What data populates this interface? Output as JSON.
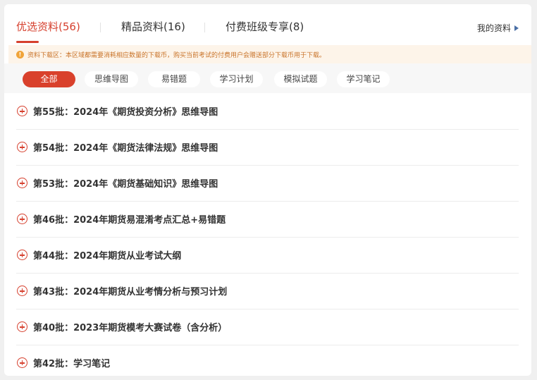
{
  "tabs": [
    {
      "label": "优选资料(56)",
      "active": true
    },
    {
      "label": "精品资料(16)",
      "active": false
    },
    {
      "label": "付费班级专享(8)",
      "active": false
    }
  ],
  "my_link": "我的资料",
  "notice": {
    "icon": "info-icon",
    "text": "资料下载区：本区域都需要消耗相应数量的下载币，购买当前考试的付费用户会赠送部分下载币用于下载。"
  },
  "filters": [
    {
      "label": "全部",
      "active": true
    },
    {
      "label": "思维导图",
      "active": false
    },
    {
      "label": "易错题",
      "active": false
    },
    {
      "label": "学习计划",
      "active": false
    },
    {
      "label": "模拟试题",
      "active": false
    },
    {
      "label": "学习笔记",
      "active": false
    }
  ],
  "items": [
    "第55批：2024年《期货投资分析》思维导图",
    "第54批：2024年《期货法律法规》思维导图",
    "第53批：2024年《期货基础知识》思维导图",
    "第46批：2024年期货易混淆考点汇总+易错题",
    "第44批：2024年期货从业考试大纲",
    "第43批：2024年期货从业考情分析与预习计划",
    "第40批：2023年期货模考大赛试卷（含分析）",
    "第42批：学习笔记"
  ],
  "colors": {
    "accent": "#d6402e",
    "notice_text": "#c9742a",
    "notice_bg": "#fdf4e9"
  }
}
